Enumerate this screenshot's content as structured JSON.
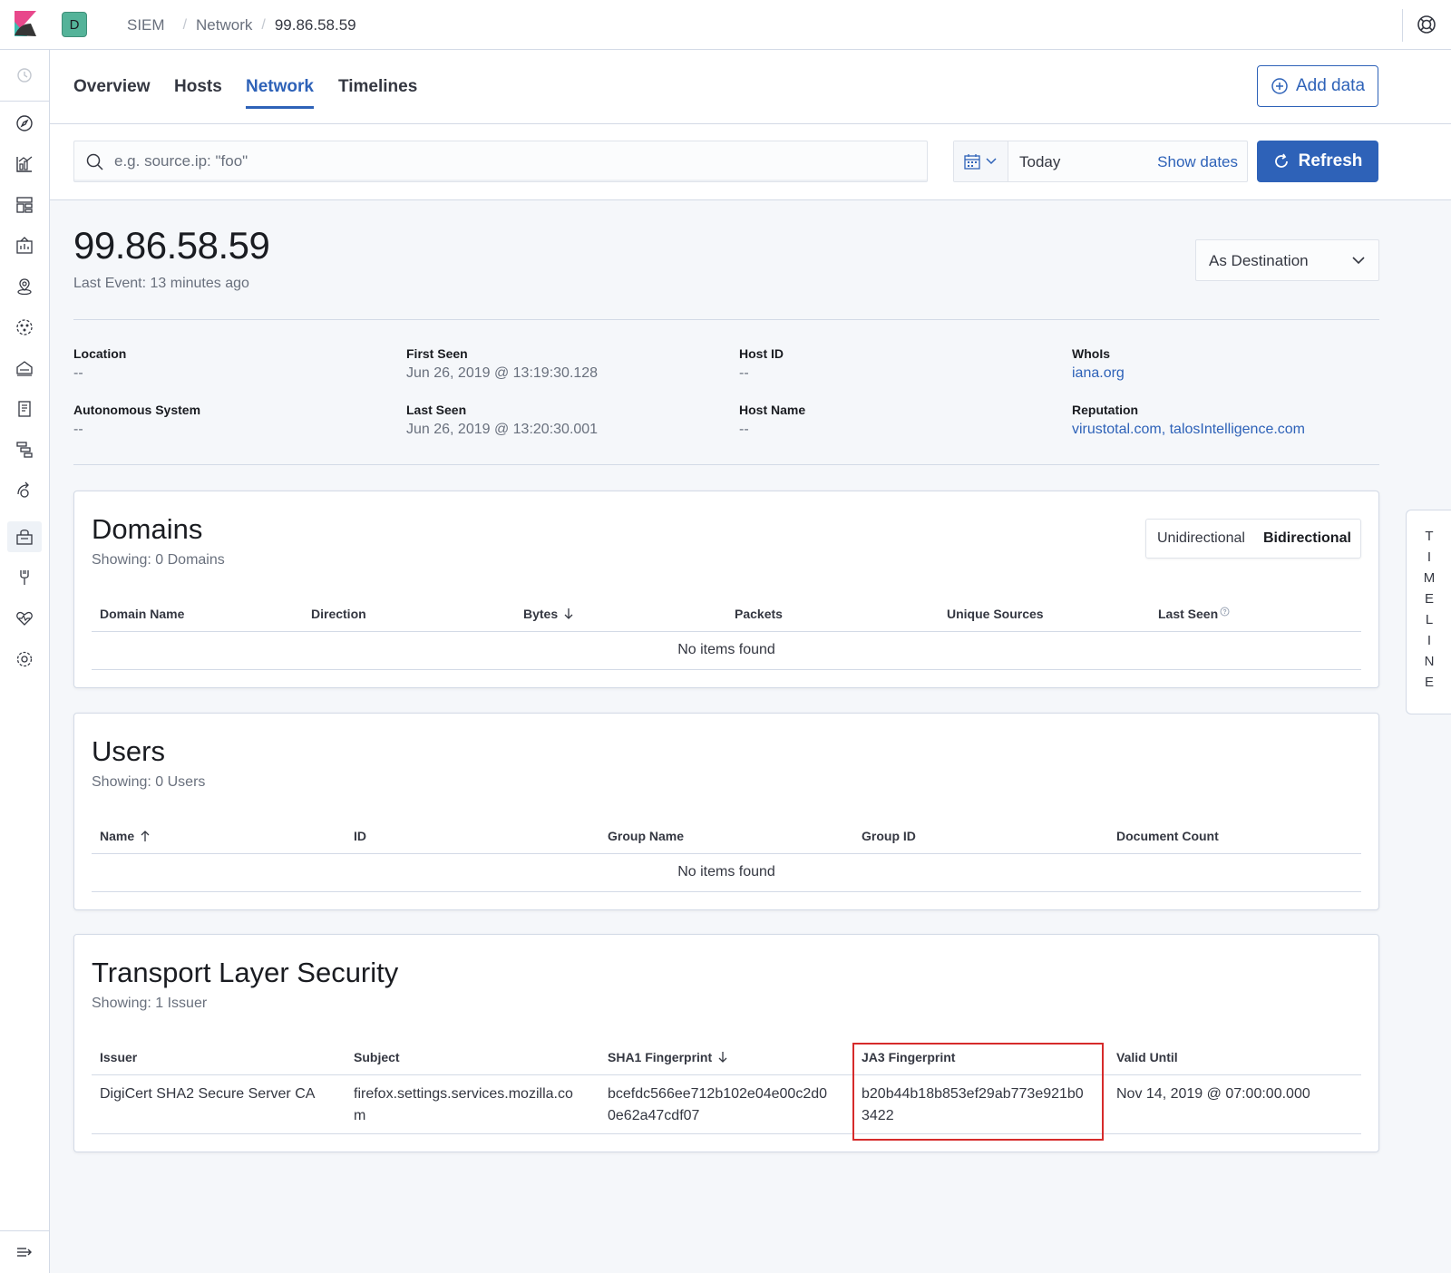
{
  "header": {
    "breadcrumbs": [
      "SIEM",
      "Network",
      "99.86.58.59"
    ],
    "space_initial": "D"
  },
  "tabs": [
    {
      "label": "Overview"
    },
    {
      "label": "Hosts"
    },
    {
      "label": "Network",
      "active": true
    },
    {
      "label": "Timelines"
    }
  ],
  "add_data_label": "Add data",
  "search": {
    "placeholder": "e.g. source.ip: \"foo\"",
    "value": ""
  },
  "date": {
    "value": "Today",
    "show_dates_label": "Show dates",
    "refresh_label": "Refresh"
  },
  "page": {
    "title": "99.86.58.59",
    "last_event": "Last Event: 13 minutes ago",
    "flow_target": "As Destination"
  },
  "details": {
    "location": {
      "title": "Location",
      "value": "--"
    },
    "autonomous_system": {
      "title": "Autonomous System",
      "value": "--"
    },
    "first_seen": {
      "title": "First Seen",
      "value": "Jun 26, 2019 @ 13:19:30.128"
    },
    "last_seen": {
      "title": "Last Seen",
      "value": "Jun 26, 2019 @ 13:20:30.001"
    },
    "host_id": {
      "title": "Host ID",
      "value": "--"
    },
    "host_name": {
      "title": "Host Name",
      "value": "--"
    },
    "whois": {
      "title": "WhoIs",
      "link": "iana.org"
    },
    "reputation": {
      "title": "Reputation",
      "link1": "virustotal.com",
      "sep": ", ",
      "link2": "talosIntelligence.com"
    }
  },
  "domains": {
    "title": "Domains",
    "showing": "Showing: 0 Domains",
    "toggle": {
      "uni": "Unidirectional",
      "bi": "Bidirectional",
      "selected": "Bidirectional"
    },
    "columns": [
      "Domain Name",
      "Direction",
      "Bytes",
      "Packets",
      "Unique Sources",
      "Last Seen"
    ],
    "empty": "No items found"
  },
  "users": {
    "title": "Users",
    "showing": "Showing: 0 Users",
    "columns": [
      "Name",
      "ID",
      "Group Name",
      "Group ID",
      "Document Count"
    ],
    "empty": "No items found"
  },
  "tls": {
    "title": "Transport Layer Security",
    "showing": "Showing: 1 Issuer",
    "columns": [
      "Issuer",
      "Subject",
      "SHA1 Fingerprint",
      "JA3 Fingerprint",
      "Valid Until"
    ],
    "rows": [
      {
        "issuer": "DigiCert SHA2 Secure Server CA",
        "subject_l1": "firefox.settings.services.mozilla.co",
        "subject_l2": "m",
        "sha1_l1": "bcefdc566ee712b102e04e00c2d0",
        "sha1_l2": "0e62a47cdf07",
        "ja3_l1": "b20b44b18b853ef29ab773e921b0",
        "ja3_l2": "3422",
        "valid_until": "Nov 14, 2019 @ 07:00:00.000"
      }
    ]
  },
  "timeline_letters": [
    "T",
    "I",
    "M",
    "E",
    "L",
    "I",
    "N",
    "E"
  ],
  "colors": {
    "accent": "#2e62b8",
    "highlight": "#d62b2b",
    "space_badge": "#54b399"
  },
  "icons": [
    "kibana-logo-icon",
    "help-icon",
    "recent-icon",
    "discover-icon",
    "visualize-icon",
    "dashboard-icon",
    "canvas-icon",
    "maps-icon",
    "ml-icon",
    "infrastructure-icon",
    "logs-icon",
    "apm-icon",
    "uptime-icon",
    "siem-icon",
    "devtools-icon",
    "monitoring-icon",
    "management-icon",
    "collapse-nav-icon",
    "search-icon",
    "calendar-icon",
    "refresh-icon",
    "plus-circle-icon",
    "chevron-down-icon",
    "sort-icon"
  ]
}
